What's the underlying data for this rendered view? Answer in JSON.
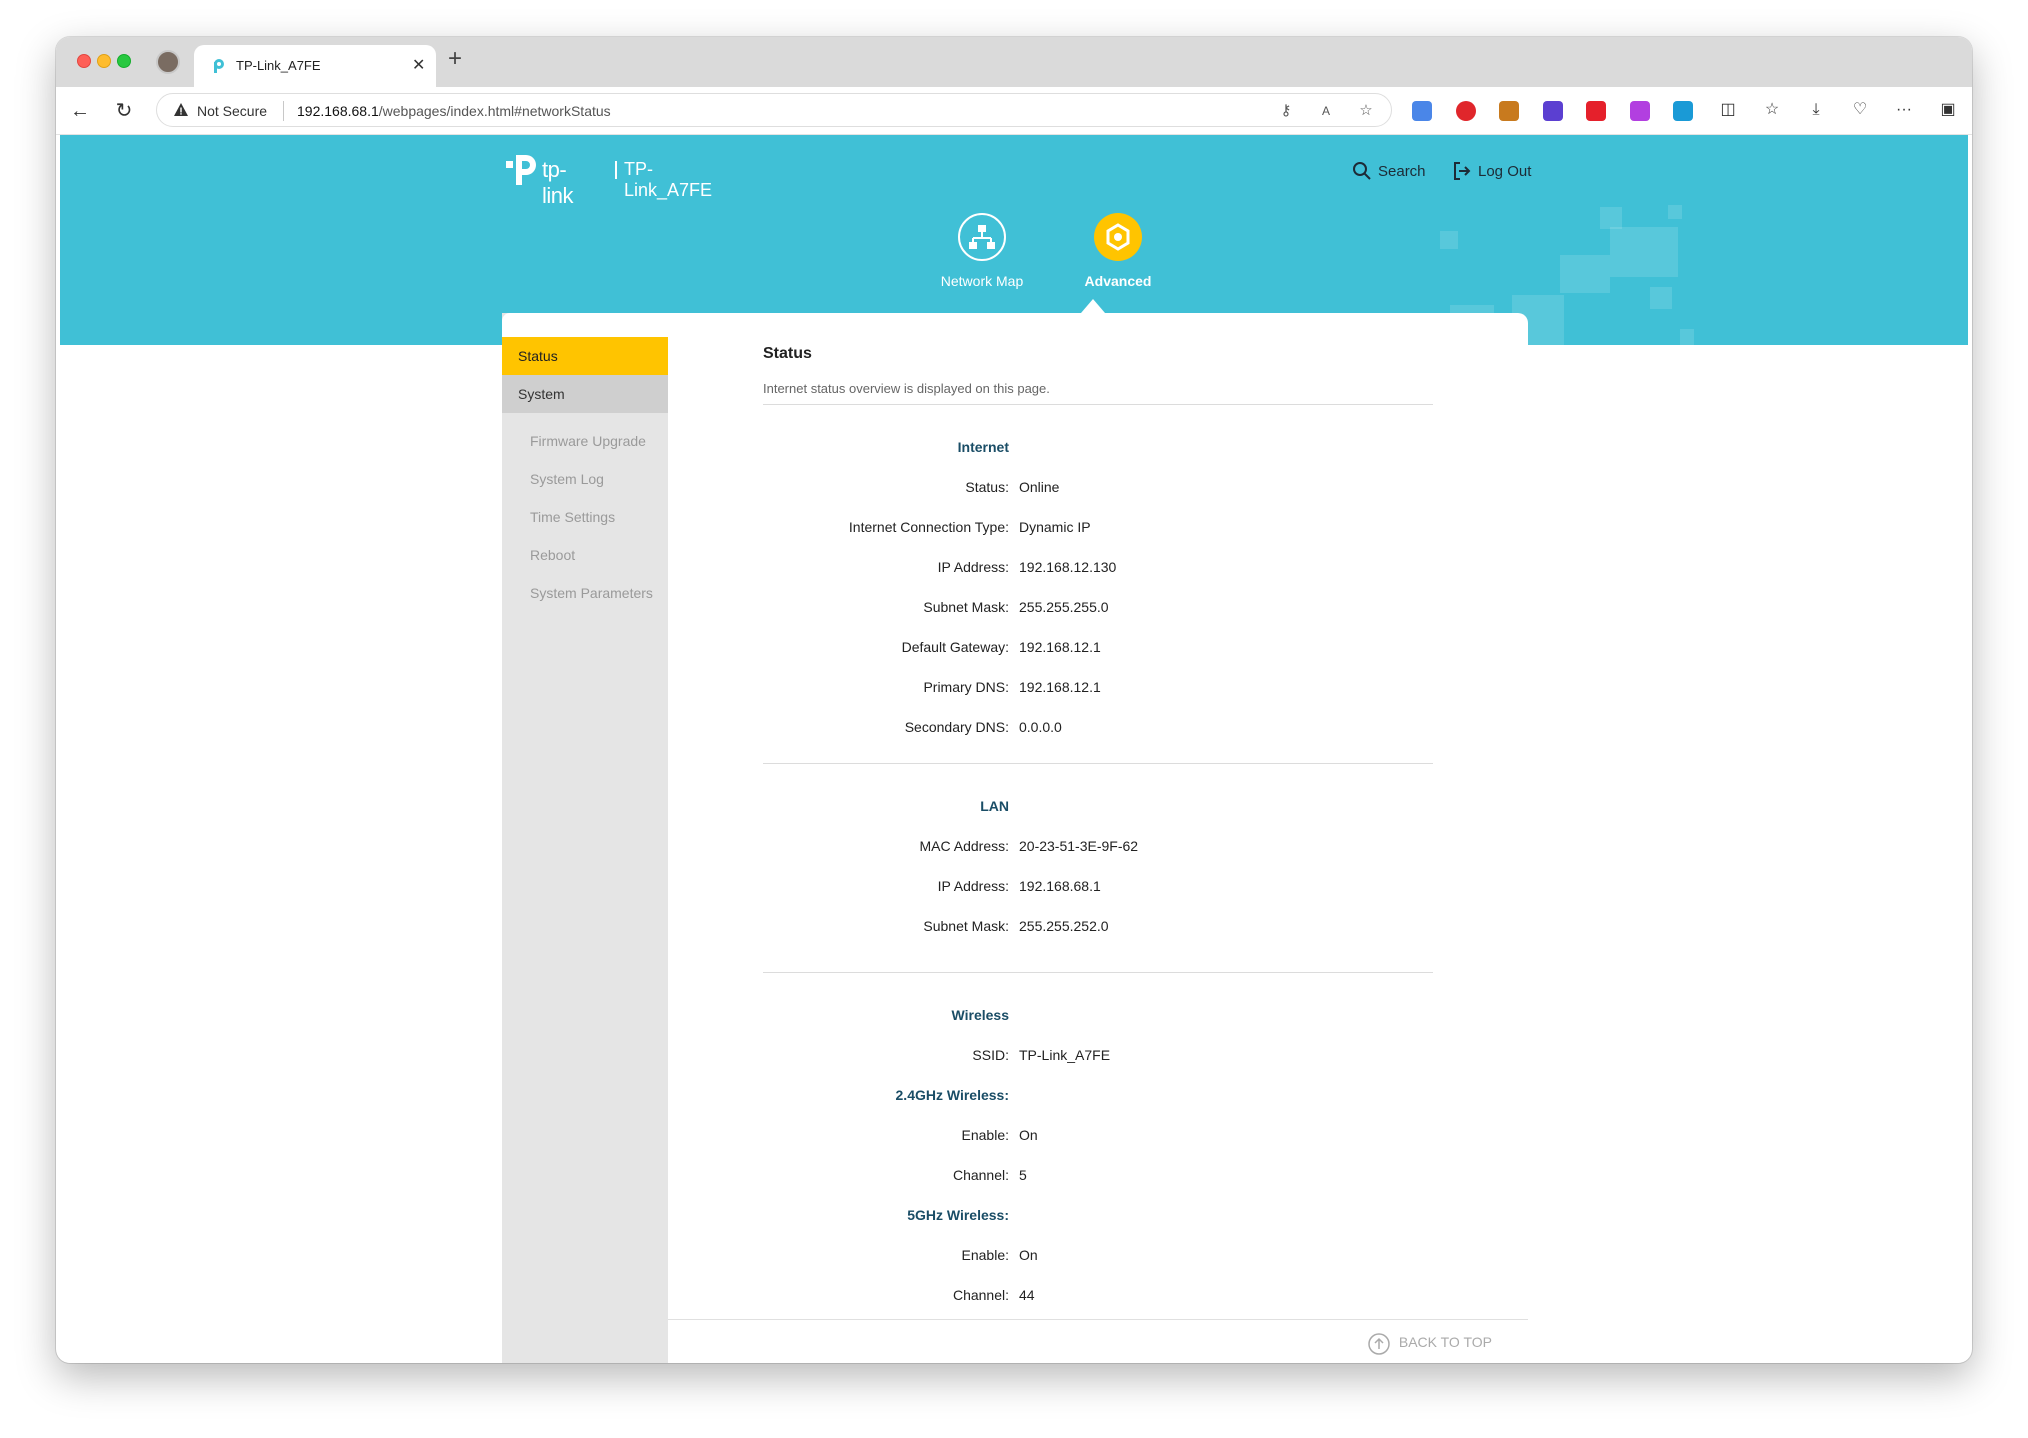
{
  "browser": {
    "tab_title": "TP-Link_A7FE",
    "not_secure": "Not Secure",
    "url_host": "192.168.68.1",
    "url_path": "/webpages/index.html#networkStatus"
  },
  "header": {
    "brand_word": "tp-link",
    "device_name": "TP-Link_A7FE",
    "search_label": "Search",
    "logout_label": "Log Out",
    "nav": [
      {
        "label": "Network Map"
      },
      {
        "label": "Advanced"
      }
    ],
    "accent_color": "#40c0d6",
    "active_color": "#ffc400"
  },
  "sidebar": {
    "items": [
      {
        "label": "Status"
      },
      {
        "label": "System"
      }
    ],
    "sub_items": [
      {
        "label": "Firmware Upgrade"
      },
      {
        "label": "System Log"
      },
      {
        "label": "Time Settings"
      },
      {
        "label": "Reboot"
      },
      {
        "label": "System Parameters"
      }
    ]
  },
  "main": {
    "title": "Status",
    "description": "Internet status overview is displayed on this page.",
    "internet": {
      "heading": "Internet",
      "rows": [
        {
          "label": "Status:",
          "value": "Online"
        },
        {
          "label": "Internet Connection Type:",
          "value": "Dynamic IP"
        },
        {
          "label": "IP Address:",
          "value": "192.168.12.130"
        },
        {
          "label": "Subnet Mask:",
          "value": "255.255.255.0"
        },
        {
          "label": "Default Gateway:",
          "value": "192.168.12.1"
        },
        {
          "label": "Primary DNS:",
          "value": "192.168.12.1"
        },
        {
          "label": "Secondary DNS:",
          "value": "0.0.0.0"
        }
      ]
    },
    "lan": {
      "heading": "LAN",
      "rows": [
        {
          "label": "MAC Address:",
          "value": "20-23-51-3E-9F-62"
        },
        {
          "label": "IP Address:",
          "value": "192.168.68.1"
        },
        {
          "label": "Subnet Mask:",
          "value": "255.255.252.0"
        }
      ]
    },
    "wireless": {
      "heading": "Wireless",
      "ssid": {
        "label": "SSID:",
        "value": "TP-Link_A7FE"
      },
      "band_24": {
        "heading": "2.4GHz Wireless:",
        "rows": [
          {
            "label": "Enable:",
            "value": "On"
          },
          {
            "label": "Channel:",
            "value": "5"
          }
        ]
      },
      "band_5": {
        "heading": "5GHz Wireless:",
        "rows": [
          {
            "label": "Enable:",
            "value": "On"
          },
          {
            "label": "Channel:",
            "value": "44"
          }
        ]
      }
    },
    "back_to_top": "BACK TO TOP"
  }
}
